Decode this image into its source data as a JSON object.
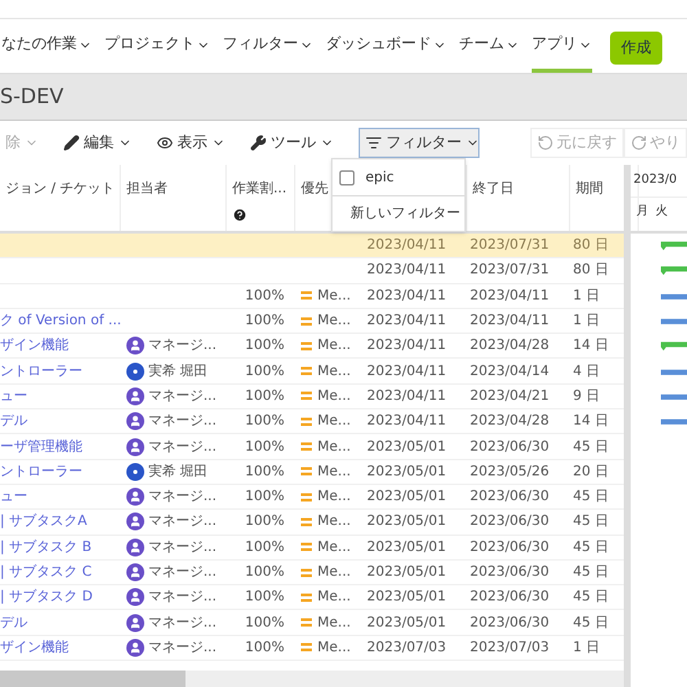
{
  "nav": {
    "items": [
      {
        "label": "なたの作業",
        "selected": false
      },
      {
        "label": "プロジェクト",
        "selected": false
      },
      {
        "label": "フィルター",
        "selected": false
      },
      {
        "label": "ダッシュボード",
        "selected": false
      },
      {
        "label": "チーム",
        "selected": false
      },
      {
        "label": "アプリ",
        "selected": true
      }
    ],
    "create": "作成"
  },
  "project": {
    "title": "S-DEV"
  },
  "toolbar": {
    "items": [
      {
        "kind": "plain",
        "label": "除",
        "disabled": true
      },
      {
        "kind": "pencil",
        "label": "編集",
        "disabled": false
      },
      {
        "kind": "eye",
        "label": "表示",
        "disabled": false
      },
      {
        "kind": "wrench",
        "label": "ツール",
        "disabled": false
      },
      {
        "kind": "filter",
        "label": "フィルター",
        "disabled": false
      }
    ],
    "undo": "元に戻す",
    "redo": "やり"
  },
  "filter_menu": {
    "items": [
      {
        "kind": "checkbox",
        "label": "epic",
        "checked": false
      },
      {
        "kind": "add",
        "label": "新しいフィルター"
      }
    ]
  },
  "table": {
    "columns": [
      "ジョン / チケット",
      "担当者",
      "作業割...",
      "優先",
      "",
      "終了日",
      "期間"
    ],
    "rows": [
      {
        "ticket": "",
        "assignee": "",
        "percent": "",
        "priority": "",
        "start": "2023/04/11",
        "end": "2023/07/31",
        "duration": "80 日",
        "selected": true,
        "bar": {
          "kind": "summary"
        }
      },
      {
        "ticket": "",
        "assignee": "",
        "percent": "",
        "priority": "",
        "start": "2023/04/11",
        "end": "2023/07/31",
        "duration": "80 日",
        "selected": false,
        "bar": {
          "kind": "summary"
        }
      },
      {
        "ticket": "",
        "assignee": "",
        "percent": "100%",
        "priority": "Me...",
        "start": "2023/04/11",
        "end": "2023/04/11",
        "duration": "1 日",
        "selected": false,
        "bar": {
          "kind": "task"
        }
      },
      {
        "ticket": "ク of Version of ...",
        "assignee": "",
        "percent": "100%",
        "priority": "Me...",
        "start": "2023/04/11",
        "end": "2023/04/11",
        "duration": "1 日",
        "selected": false,
        "bar": {
          "kind": "task"
        }
      },
      {
        "ticket": "ザイン機能",
        "assignee": "マネージ...",
        "avatar": {
          "kind": "user"
        },
        "percent": "100%",
        "priority": "Me...",
        "start": "2023/04/11",
        "end": "2023/04/28",
        "duration": "14 日",
        "selected": false,
        "bar": {
          "kind": "summary"
        }
      },
      {
        "ticket": "ントローラー",
        "assignee": "実希 堀田",
        "avatar": {
          "kind": "initial"
        },
        "percent": "100%",
        "priority": "Me...",
        "start": "2023/04/11",
        "end": "2023/04/14",
        "duration": "4 日",
        "selected": false,
        "bar": {
          "kind": "task"
        }
      },
      {
        "ticket": "ュー",
        "assignee": "マネージ...",
        "avatar": {
          "kind": "user"
        },
        "percent": "100%",
        "priority": "Me...",
        "start": "2023/04/11",
        "end": "2023/04/21",
        "duration": "9 日",
        "selected": false,
        "bar": {
          "kind": "task"
        }
      },
      {
        "ticket": "デル",
        "assignee": "マネージ...",
        "avatar": {
          "kind": "user"
        },
        "percent": "100%",
        "priority": "Me...",
        "start": "2023/04/11",
        "end": "2023/04/28",
        "duration": "14 日",
        "selected": false,
        "bar": {
          "kind": "task"
        }
      },
      {
        "ticket": "ーザ管理機能",
        "assignee": "マネージ...",
        "avatar": {
          "kind": "user"
        },
        "percent": "100%",
        "priority": "Me...",
        "start": "2023/05/01",
        "end": "2023/06/30",
        "duration": "45 日",
        "selected": false
      },
      {
        "ticket": "ントローラー",
        "assignee": "実希 堀田",
        "avatar": {
          "kind": "initial"
        },
        "percent": "100%",
        "priority": "Me...",
        "start": "2023/05/01",
        "end": "2023/05/26",
        "duration": "20 日",
        "selected": false
      },
      {
        "ticket": "ュー",
        "assignee": "マネージ...",
        "avatar": {
          "kind": "user"
        },
        "percent": "100%",
        "priority": "Me...",
        "start": "2023/05/01",
        "end": "2023/06/30",
        "duration": "45 日",
        "selected": false
      },
      {
        "ticket": "| サブタスクA",
        "assignee": "マネージ...",
        "avatar": {
          "kind": "user"
        },
        "percent": "100%",
        "priority": "Me...",
        "start": "2023/05/01",
        "end": "2023/06/30",
        "duration": "45 日",
        "selected": false
      },
      {
        "ticket": "| サブタスク B",
        "assignee": "マネージ...",
        "avatar": {
          "kind": "user"
        },
        "percent": "100%",
        "priority": "Me...",
        "start": "2023/05/01",
        "end": "2023/06/30",
        "duration": "45 日",
        "selected": false
      },
      {
        "ticket": "| サブタスク C",
        "assignee": "マネージ...",
        "avatar": {
          "kind": "user"
        },
        "percent": "100%",
        "priority": "Me...",
        "start": "2023/05/01",
        "end": "2023/06/30",
        "duration": "45 日",
        "selected": false
      },
      {
        "ticket": "| サブタスク D",
        "assignee": "マネージ...",
        "avatar": {
          "kind": "user"
        },
        "percent": "100%",
        "priority": "Me...",
        "start": "2023/05/01",
        "end": "2023/06/30",
        "duration": "45 日",
        "selected": false
      },
      {
        "ticket": "デル",
        "assignee": "マネージ...",
        "avatar": {
          "kind": "user"
        },
        "percent": "100%",
        "priority": "Me...",
        "start": "2023/05/01",
        "end": "2023/06/30",
        "duration": "45 日",
        "selected": false
      },
      {
        "ticket": "ザイン機能",
        "assignee": "マネージ...",
        "avatar": {
          "kind": "user"
        },
        "percent": "100%",
        "priority": "Me...",
        "start": "2023/07/03",
        "end": "2023/07/03",
        "duration": "1 日",
        "selected": false
      }
    ]
  },
  "gantt": {
    "month": "2023/0",
    "days": [
      "月",
      "火"
    ]
  }
}
